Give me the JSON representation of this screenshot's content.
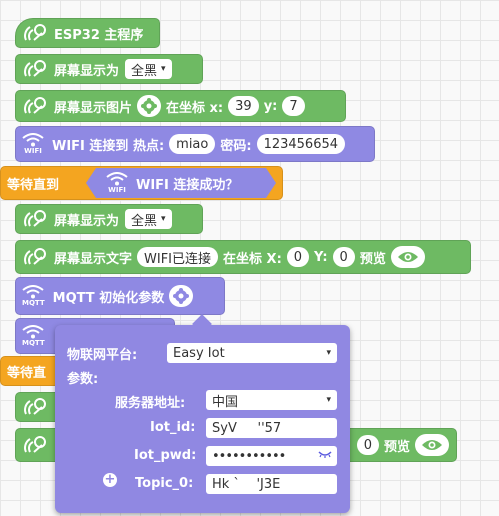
{
  "blocks": {
    "main_program": {
      "label": "ESP32 主程序"
    },
    "screen_display_1": {
      "label": "屏幕显示为",
      "option": "全黑",
      "arrow": "▾"
    },
    "screen_image": {
      "label": "屏幕显示图片",
      "coord_label": "在坐标 x:",
      "x": "39",
      "y_label": "y:",
      "y": "7"
    },
    "wifi_connect": {
      "label": "WIFI 连接到 热点:",
      "ssid": "miao",
      "pwd_label": "密码:",
      "password": "123456654",
      "icon_text": "WIFI"
    },
    "wait_until": {
      "label": "等待直到",
      "cond_label": "WIFI 连接成功？",
      "icon_text": "WIFI"
    },
    "screen_display_2": {
      "label": "屏幕显示为",
      "option": "全黑",
      "arrow": "▾"
    },
    "screen_text": {
      "label": "屏幕显示文字",
      "text": "WIFI已连接",
      "coord_label": "在坐标 X:",
      "x": "0",
      "y_label": "Y:",
      "y": "0",
      "preview_label": "预览"
    },
    "mqtt_init": {
      "label": "MQTT 初始化参数",
      "icon_text": "MQTT"
    },
    "wait_partial": {
      "label": "等待直"
    },
    "hidden_preview": {
      "value": "0",
      "preview_label": "预览"
    },
    "mqtt_hidden": {
      "icon_text": "MQTT"
    }
  },
  "panel": {
    "platform_label": "物联网平台:",
    "platform_value": "Easy Iot",
    "params_label": "参数:",
    "server_label": "服务器地址:",
    "server_value": "中国",
    "iot_id_label": "Iot_id:",
    "iot_id_value": "SyV     ''57",
    "iot_pwd_label": "Iot_pwd:",
    "iot_pwd_value": "•••••••••••",
    "topic_label": "Topic_0:",
    "topic_value": "Hk `    'J3E",
    "add_symbol": "+",
    "arrow": "▾"
  },
  "colors": {
    "green": "#6eba63",
    "purple": "#8f89e3",
    "orange": "#f4a520"
  }
}
